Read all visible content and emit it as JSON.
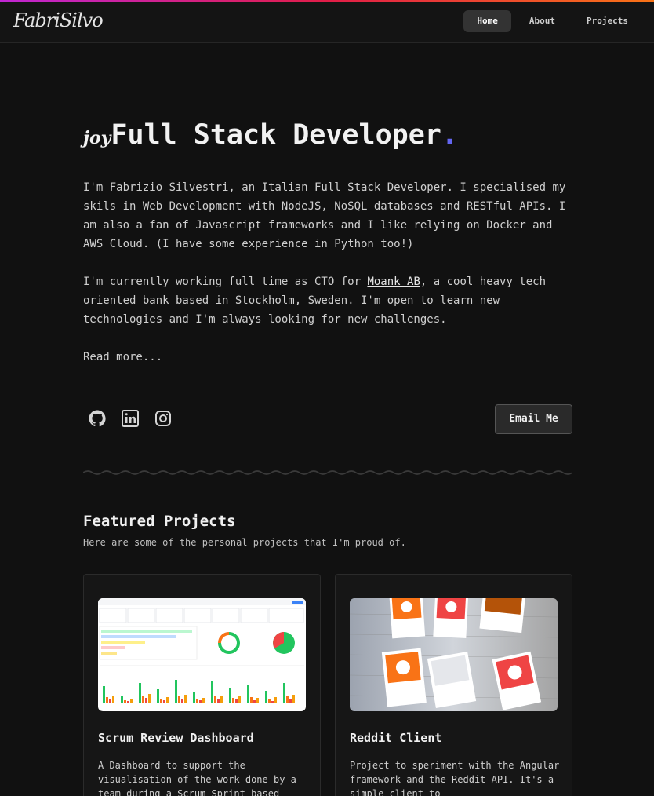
{
  "header": {
    "logo": "FabriSilvo",
    "nav": [
      "Home",
      "About",
      "Projects"
    ],
    "active": "Home"
  },
  "hero": {
    "prefix": "joy",
    "title": "Full Stack Developer",
    "dot": ".",
    "intro": "I'm Fabrizio Silvestri, an Italian Full Stack Developer. I specialised my skils in Web Development with NodeJS, NoSQL databases and RESTful APIs. I am also a fan of Javascript frameworks and I like relying on Docker and AWS Cloud. (I have some experience in Python too!)",
    "work_before": "I'm currently working full time as CTO for ",
    "work_link": "Moank AB",
    "work_after": ", a cool heavy tech oriented bank based in Stockholm, Sweden. I'm open to learn new technologies and I'm always looking for new challenges.",
    "read_more": "Read more..."
  },
  "contact": {
    "email_button": "Email Me",
    "socials": [
      "github-icon",
      "linkedin-icon",
      "instagram-icon"
    ]
  },
  "featured": {
    "title": "Featured Projects",
    "subtitle": "Here are some of the personal projects that I'm proud of.",
    "projects": [
      {
        "title": "Scrum Review Dashboard",
        "description": "A Dashboard to support the visualisation of the work done by a team during a Scrum Sprint based"
      },
      {
        "title": "Reddit Client",
        "description": "Project to speriment with the Angular framework and the Reddit API. It's a simple client to"
      }
    ]
  },
  "colors": {
    "accent": "#6366f1",
    "background": "#111111",
    "gradient_start": "#c026d3",
    "gradient_end": "#f97316"
  }
}
